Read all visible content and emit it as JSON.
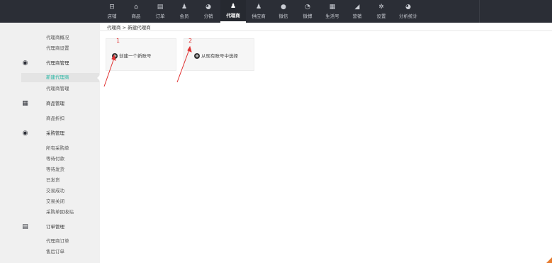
{
  "topnav": {
    "items": [
      {
        "label": "店铺",
        "icon": "store-icon",
        "glyph": "⊟"
      },
      {
        "label": "商品",
        "icon": "basket-icon",
        "glyph": "⌂"
      },
      {
        "label": "订单",
        "icon": "order-icon",
        "glyph": "▤"
      },
      {
        "label": "会员",
        "icon": "member-icon",
        "glyph": "♟"
      },
      {
        "label": "分销",
        "icon": "distribution-icon",
        "glyph": "◕"
      },
      {
        "label": "代理商",
        "icon": "agent-icon",
        "glyph": "♟"
      },
      {
        "label": "供应商",
        "icon": "supplier-icon",
        "glyph": "♟"
      },
      {
        "label": "微信",
        "icon": "wechat-icon",
        "glyph": "●"
      },
      {
        "label": "微博",
        "icon": "weibo-icon",
        "glyph": "◔"
      },
      {
        "label": "生活号",
        "icon": "life-icon",
        "glyph": "▦"
      },
      {
        "label": "营销",
        "icon": "marketing-icon",
        "glyph": "◢"
      },
      {
        "label": "设置",
        "icon": "settings-icon",
        "glyph": "✲"
      },
      {
        "label": "分析统计",
        "icon": "analytics-icon",
        "glyph": "◕"
      }
    ],
    "active_index": 5
  },
  "sidebar": {
    "items": [
      {
        "label": "代理商概况",
        "type": "link"
      },
      {
        "label": "代理商设置",
        "type": "link"
      },
      {
        "label": "代理商管理",
        "type": "category",
        "icon": "user-circle-icon",
        "glyph": "◉"
      },
      {
        "label": "新建代理商",
        "type": "active"
      },
      {
        "label": "代理商管理",
        "type": "link"
      },
      {
        "label": "商品管理",
        "type": "category",
        "icon": "grid-icon",
        "glyph": "▦"
      },
      {
        "label": "商品折扣",
        "type": "link"
      },
      {
        "label": "采购管理",
        "type": "category",
        "icon": "cart-icon",
        "glyph": "◉"
      },
      {
        "label": "所有采购单",
        "type": "link"
      },
      {
        "label": "等待付款",
        "type": "link"
      },
      {
        "label": "等待发货",
        "type": "link"
      },
      {
        "label": "已发货",
        "type": "link"
      },
      {
        "label": "交易成功",
        "type": "link"
      },
      {
        "label": "交易关闭",
        "type": "link"
      },
      {
        "label": "采购单回收站",
        "type": "link"
      },
      {
        "label": "订单管理",
        "type": "category",
        "icon": "document-icon",
        "glyph": "▤"
      },
      {
        "label": "代理商订单",
        "type": "link"
      },
      {
        "label": "售后订单",
        "type": "link"
      }
    ]
  },
  "breadcrumb": {
    "parent": "代理商",
    "separator": ">",
    "current": "新建代理商"
  },
  "cards": [
    {
      "number": "1",
      "label": "创建一个新账号"
    },
    {
      "number": "2",
      "label": "从现有账号中选择"
    }
  ],
  "colors": {
    "topbar_bg": "#2b2e36",
    "accent_teal": "#25b6a3",
    "annotation_red": "#e03030"
  }
}
